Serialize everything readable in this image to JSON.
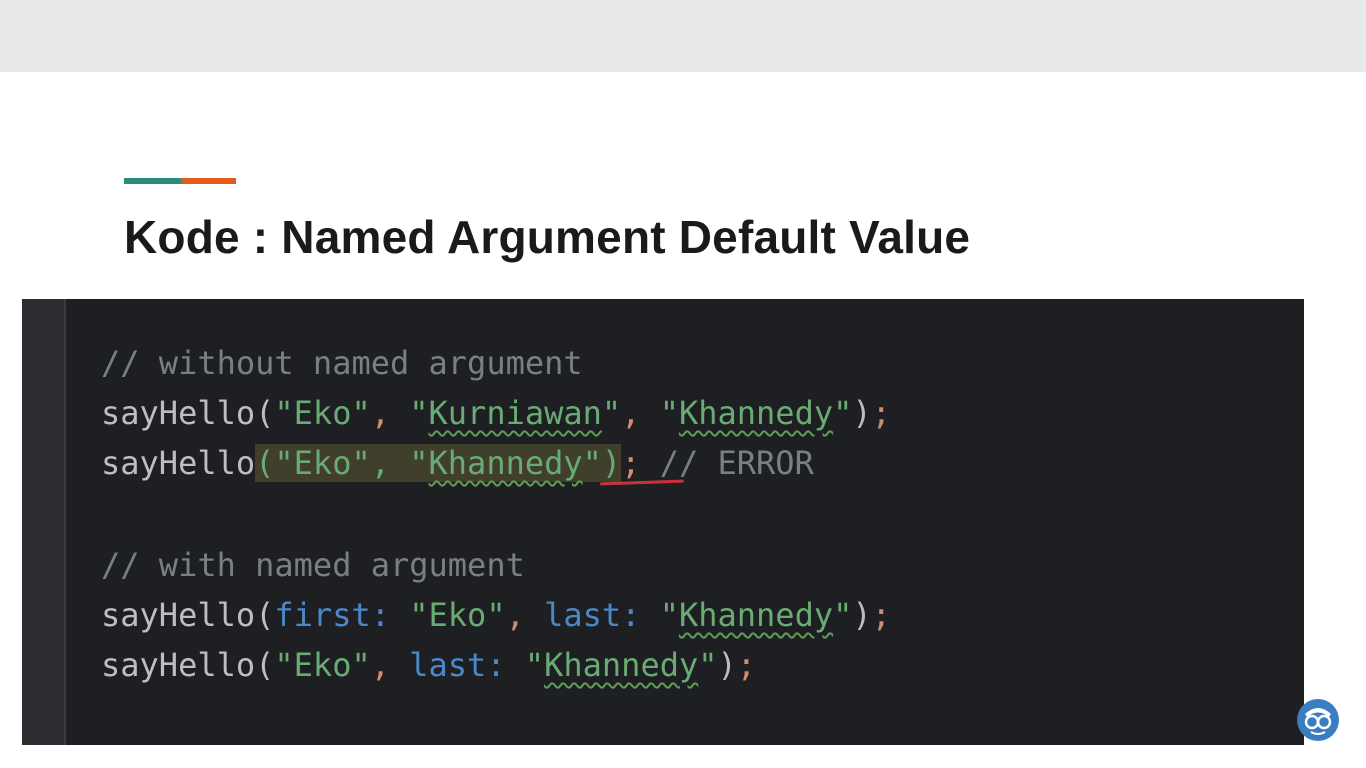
{
  "slide": {
    "title": "Kode : Named Argument Default Value",
    "accent_colors": [
      "#2a8a7c",
      "#e25a1c"
    ],
    "background": "#ffffff",
    "topbar_color": "#e7eae9"
  },
  "code": {
    "lines": [
      {
        "id": "c1",
        "tokens": [
          {
            "t": "// without named argument",
            "k": "comment"
          }
        ]
      },
      {
        "id": "l1",
        "tokens": [
          {
            "t": "sayHello(",
            "k": "fn"
          },
          {
            "t": "\"Eko\"",
            "k": "str"
          },
          {
            "t": ", ",
            "k": "comma"
          },
          {
            "t": "\"",
            "k": "str"
          },
          {
            "t": "Kurniawan",
            "k": "str",
            "squiggle": true
          },
          {
            "t": "\"",
            "k": "str"
          },
          {
            "t": ", ",
            "k": "comma"
          },
          {
            "t": "\"",
            "k": "str"
          },
          {
            "t": "Khannedy",
            "k": "str",
            "squiggle": true
          },
          {
            "t": "\"",
            "k": "str"
          },
          {
            "t": ")",
            "k": "punct"
          },
          {
            "t": ";",
            "k": "semi"
          }
        ]
      },
      {
        "id": "l2",
        "tokens": [
          {
            "t": "sayHello",
            "k": "fn"
          },
          {
            "t": "(\"Eko\", \"",
            "k": "str",
            "hl": true
          },
          {
            "t": "Khannedy",
            "k": "str",
            "hl": true,
            "squiggle": true
          },
          {
            "t": "\")",
            "k": "str",
            "hl": true
          },
          {
            "t": "; ",
            "k": "semi"
          },
          {
            "t": "// ",
            "k": "comment"
          },
          {
            "t": "ERROR",
            "k": "comment"
          }
        ]
      },
      {
        "id": "blank",
        "tokens": []
      },
      {
        "id": "c2",
        "tokens": [
          {
            "t": "// with named argument",
            "k": "comment"
          }
        ]
      },
      {
        "id": "l3",
        "tokens": [
          {
            "t": "sayHello(",
            "k": "fn"
          },
          {
            "t": "first: ",
            "k": "param"
          },
          {
            "t": "\"Eko\"",
            "k": "str"
          },
          {
            "t": ", ",
            "k": "comma"
          },
          {
            "t": "last: ",
            "k": "param"
          },
          {
            "t": "\"",
            "k": "str"
          },
          {
            "t": "Khannedy",
            "k": "str",
            "squiggle": true
          },
          {
            "t": "\"",
            "k": "str"
          },
          {
            "t": ")",
            "k": "punct"
          },
          {
            "t": ";",
            "k": "semi"
          }
        ]
      },
      {
        "id": "l4",
        "tokens": [
          {
            "t": "sayHello(",
            "k": "fn"
          },
          {
            "t": "\"Eko\"",
            "k": "str"
          },
          {
            "t": ", ",
            "k": "comma"
          },
          {
            "t": "last: ",
            "k": "param"
          },
          {
            "t": "\"",
            "k": "str"
          },
          {
            "t": "Khannedy",
            "k": "str",
            "squiggle": true
          },
          {
            "t": "\"",
            "k": "str"
          },
          {
            "t": ")",
            "k": "punct"
          },
          {
            "t": ";",
            "k": "semi"
          }
        ]
      }
    ]
  },
  "logo": {
    "icon": "glasses-mascot-icon",
    "color": "#3a7dc0"
  }
}
